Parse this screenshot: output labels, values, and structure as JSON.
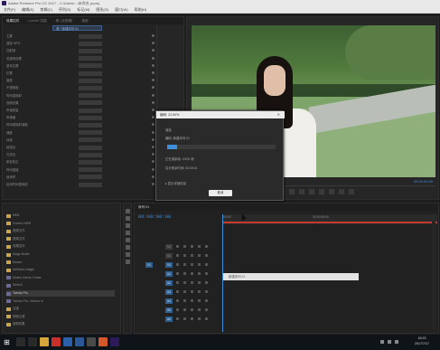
{
  "window": {
    "title": "Adobe Premiere Pro CC 2017 - C:\\Users\\...\\未命名.prproj"
  },
  "menu": [
    "文件(F)",
    "编辑(E)",
    "剪辑(C)",
    "序列(S)",
    "标记(M)",
    "图形(G)",
    "窗口(W)",
    "帮助(H)"
  ],
  "effect_panel": {
    "tabs": [
      "效果控件",
      "Lumetri 范围",
      "源: (无剪辑)",
      "音频"
    ],
    "active_tab": "效果控件",
    "sub_tab": "源 * 新建序列 01",
    "rows": [
      "主要",
      "渲染 MPG",
      "匹配帧",
      "关键帧设置",
      "基本位置",
      "位置",
      "缩放",
      "不透明度",
      "时间重映射",
      "音频效果",
      "声道音量",
      "声像器",
      "时间重映射速度",
      "速度",
      "持续",
      "帧混合",
      "光流法",
      "颜色校正",
      "时间插值",
      "帧采样",
      "启用时间重映射"
    ]
  },
  "program_monitor": {
    "timecode": "00:00:00:00",
    "transport_buttons": [
      "mark-in",
      "mark-out",
      "go-to-in",
      "step-back",
      "play",
      "step-forward",
      "go-to-out",
      "lift",
      "extract",
      "export-frame"
    ]
  },
  "project_panel": {
    "items": [
      {
        "label": "MKB",
        "type": "folder"
      },
      {
        "label": "Content MKB",
        "type": "folder"
      },
      {
        "label": "音频文件",
        "type": "folder"
      },
      {
        "label": "视频文件",
        "type": "folder"
      },
      {
        "label": "效果控件",
        "type": "folder"
      },
      {
        "label": "Magic Bullet",
        "type": "folder"
      },
      {
        "label": "Mocha",
        "type": "folder"
      },
      {
        "label": "ArtWorks Magic",
        "type": "folder"
      },
      {
        "label": "Motion Intens Create",
        "type": "clip"
      },
      {
        "label": "Stretch",
        "type": "clip"
      },
      {
        "label": "Twixtor Pro",
        "type": "clip",
        "selected": true
      },
      {
        "label": "Twixtor Pro, Vectors In",
        "type": "clip"
      },
      {
        "label": "过渡",
        "type": "folder"
      },
      {
        "label": "视频过渡",
        "type": "folder"
      },
      {
        "label": "音频效果",
        "type": "folder"
      }
    ]
  },
  "timeline": {
    "tab": "序列 01",
    "timecode": "00:00:00:00",
    "ruler_labels": [
      "00:00",
      "00:00:05:00"
    ],
    "tracks": [
      {
        "label": "V3",
        "active": false
      },
      {
        "label": "V2",
        "active": false
      },
      {
        "label": "V1",
        "active": true,
        "source": "V1"
      },
      {
        "label": "A1",
        "active": true
      },
      {
        "label": "A2",
        "active": true
      },
      {
        "label": "A3",
        "active": true
      },
      {
        "label": "A4",
        "active": true
      },
      {
        "label": "A5",
        "active": true
      },
      {
        "label": "A6",
        "active": true
      }
    ],
    "clip_label": "新建序列 01"
  },
  "export_dialog": {
    "title": "编码: 22.54%",
    "section": "渲染",
    "line1": "编码: 新建序列 01",
    "line2": "正在渲染帧: 2/100 帧",
    "line3": "估计剩余时间: 00:00:01",
    "progress": 0.2254,
    "details_toggle": "显示详细信息",
    "cancel_label": "取消"
  },
  "taskbar": {
    "time": "16:23",
    "date": "2017/7/17",
    "apps": [
      {
        "name": "search",
        "color": "#2a2a2a"
      },
      {
        "name": "task-view",
        "color": "#2a2a2a"
      },
      {
        "name": "explorer",
        "color": "#d6a63a"
      },
      {
        "name": "app-red",
        "color": "#c8302a"
      },
      {
        "name": "app-blue",
        "color": "#2b5fa8"
      },
      {
        "name": "word",
        "color": "#2b5797"
      },
      {
        "name": "app-gray",
        "color": "#4a4a4a"
      },
      {
        "name": "app-orange",
        "color": "#d2572b"
      },
      {
        "name": "premiere",
        "color": "#2c1a5a"
      }
    ]
  }
}
